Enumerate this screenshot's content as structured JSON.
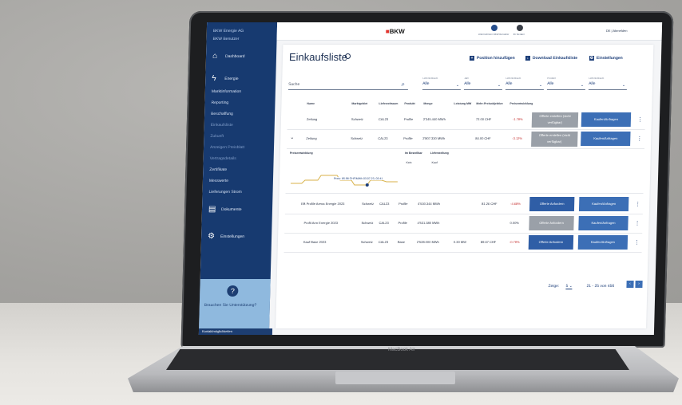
{
  "sidebar": {
    "org": "BKW Energie AG",
    "account": "BKW Benutzer",
    "items": [
      {
        "label": "Dashboard",
        "icon": "home-icon"
      },
      {
        "label": "Energie",
        "icon": "bolt-icon"
      }
    ],
    "subitems": [
      "Marktinformation",
      "Reporting",
      "Beschaffung",
      "Einkaufsliste",
      "Zukunft",
      "Anzeigen Preisblatt",
      "Vertragsdetails",
      "Zertifikate",
      "Messwerte",
      "Lieferungen Strom"
    ],
    "dokumente": "Dokumente",
    "settings": "Einstellungen",
    "help_text": "Brauchen Sie Unterstützung?",
    "help_link": "Kontaktmöglichkeiten"
  },
  "topbar": {
    "logo": "BKW",
    "icon1_label": "Unternehmen BKW Benutzer",
    "icon2_label": "Ihr Berater",
    "user": "DE | Abmelden"
  },
  "page": {
    "title": "Einkaufsliste",
    "actions": [
      "Position hinzufügen",
      "Download Einkaufsliste",
      "Einstellungen"
    ],
    "search_placeholder": "Suche"
  },
  "filters": [
    {
      "label": "Lieferzeitraum",
      "value": "Alle"
    },
    {
      "label": "Jahr",
      "value": "Alle"
    },
    {
      "label": "Lieferzeitraum",
      "value": "Alle"
    },
    {
      "label": "Produkt",
      "value": "Alle"
    },
    {
      "label": "Lieferzeitraum",
      "value": "Alle"
    }
  ],
  "table": {
    "headers": [
      "Name",
      "Marktgebiet",
      "Lieferzeitraum",
      "Produkt",
      "Menge",
      "Leistung MW",
      "Mehr-Preisobjektive",
      "Preisentwicklung"
    ],
    "rows": [
      {
        "name": "Zeitung",
        "area": "Schweiz",
        "period": "CAL23",
        "product": "Profile",
        "qty": "2'345.440 MWh",
        "mw": "",
        "price": "72.00 CHF",
        "change": "-1.79%",
        "btn1": "Offerte erstellen (nicht verfügbar)",
        "btn2": "Kaufen/Anfragen"
      },
      {
        "name": "Zeitung",
        "area": "Schweiz",
        "period": "CAL23",
        "product": "Profile",
        "qty": "2'807.330 MWh",
        "mw": "",
        "price": "84.00 CHF",
        "change": "-3.12%",
        "btn1": "Offerte erstellen (nicht verfügbar)",
        "btn2": "Kaufen/Anfragen"
      },
      {
        "name": "EB Profile Arena Energie 2023",
        "area": "Schweiz",
        "period": "CAL23",
        "product": "Profile",
        "qty": "4'530.344 MWh",
        "mw": "",
        "price": "81.26 CHF",
        "change": "-4.68%",
        "btn1": "Offerte Anfordern",
        "btn2": "Kaufen/Anfragen"
      },
      {
        "name": "Profit Arm Energie 2023",
        "area": "Schweiz",
        "period": "CAL23",
        "product": "Profile",
        "qty": "4'531.380 MWh",
        "mw": "",
        "price": "",
        "change": "0.00%",
        "btn1": "Offerte Anfordern",
        "btn2": "Kaufen/Anfragen"
      },
      {
        "name": "Kauf Base 2023",
        "area": "Schweiz",
        "period": "CAL23",
        "product": "Base",
        "qty": "2'528.000 MWh",
        "mw": "0.30 MW",
        "price": "89.67 CHF",
        "change": "-0.79%",
        "btn1": "Offerte Anfordern",
        "btn2": "Kaufen/Anfragen"
      }
    ],
    "detail": {
      "section_label": "Preisentwicklung",
      "col_a": "Im Bestellbar",
      "col_b": "Lieferstellung",
      "val_a": "Kein",
      "val_b": "Kauf",
      "tooltip": "Preis: 85.98 CHF/MWh 03.07.23, 02:41"
    }
  },
  "pager": {
    "label": "Zeige:",
    "per_page": "5",
    "range": "21 - 25 von 456"
  },
  "laptop_brand": "MacBook Air",
  "colors": {
    "primary": "#173a70",
    "button": "#3c6fb6",
    "negative": "#c42e2e",
    "chart": "#d8b24a"
  }
}
